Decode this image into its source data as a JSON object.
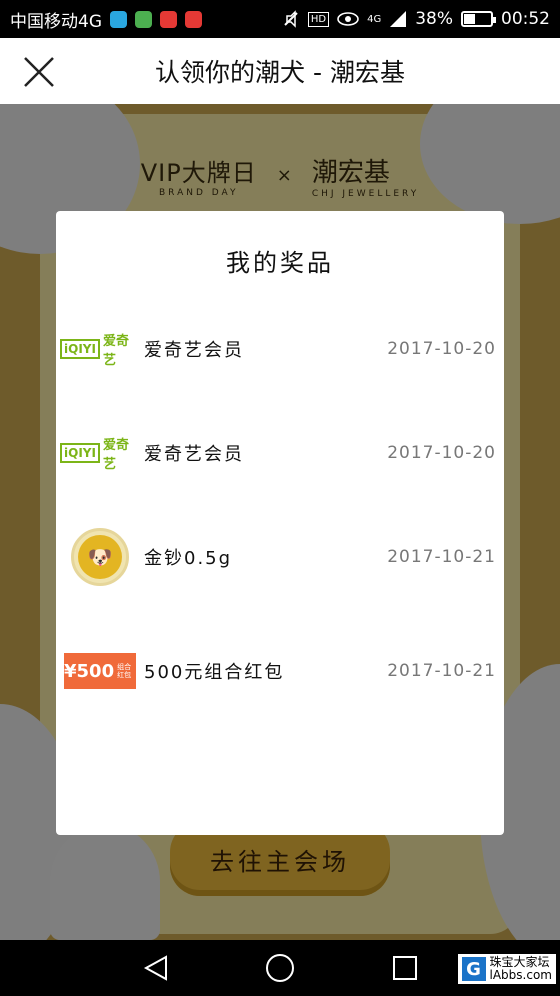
{
  "status_bar": {
    "carrier": "中国移动4G",
    "battery": "38%",
    "battery_level": 0.38,
    "network": "4G",
    "hd": "HD",
    "time": "00:52",
    "icons": [
      "message-icon",
      "app-icon",
      "trash-icon",
      "no-sign-icon",
      "mute-icon",
      "eye-icon",
      "signal-icon",
      "battery-icon"
    ]
  },
  "title_bar": {
    "title": "认领你的潮犬 - 潮宏基",
    "close_icon": "close-icon"
  },
  "background": {
    "brand_left": "VIP大牌日",
    "brand_left_sub": "BRAND DAY",
    "brand_sep": "×",
    "brand_right": "潮宏基",
    "brand_right_sub": "CHJ JEWELLERY",
    "main_button": "去往主会场"
  },
  "modal": {
    "title": "我的奖品",
    "prizes": [
      {
        "name": "爱奇艺会员",
        "date": "2017-10-20",
        "thumb": "iqiyi-logo",
        "thumb_box": "iQIYI",
        "thumb_text": "爱奇艺"
      },
      {
        "name": "爱奇艺会员",
        "date": "2017-10-20",
        "thumb": "iqiyi-logo",
        "thumb_box": "iQIYI",
        "thumb_text": "爱奇艺"
      },
      {
        "name": "金钞0.5g",
        "date": "2017-10-21",
        "thumb": "gold-coin"
      },
      {
        "name": "500元组合红包",
        "date": "2017-10-21",
        "thumb": "red-packet",
        "thumb_amount": "¥500",
        "thumb_label": "组合红包"
      }
    ]
  },
  "nav_bar": {
    "watermark": "珠宝大家坛",
    "watermark_sub": "lAbbs.com",
    "watermark_logo": "G"
  },
  "colors": {
    "accent": "#e7b73b",
    "iqiyi_green": "#7cb518",
    "red_packet": "#f06a3a"
  }
}
